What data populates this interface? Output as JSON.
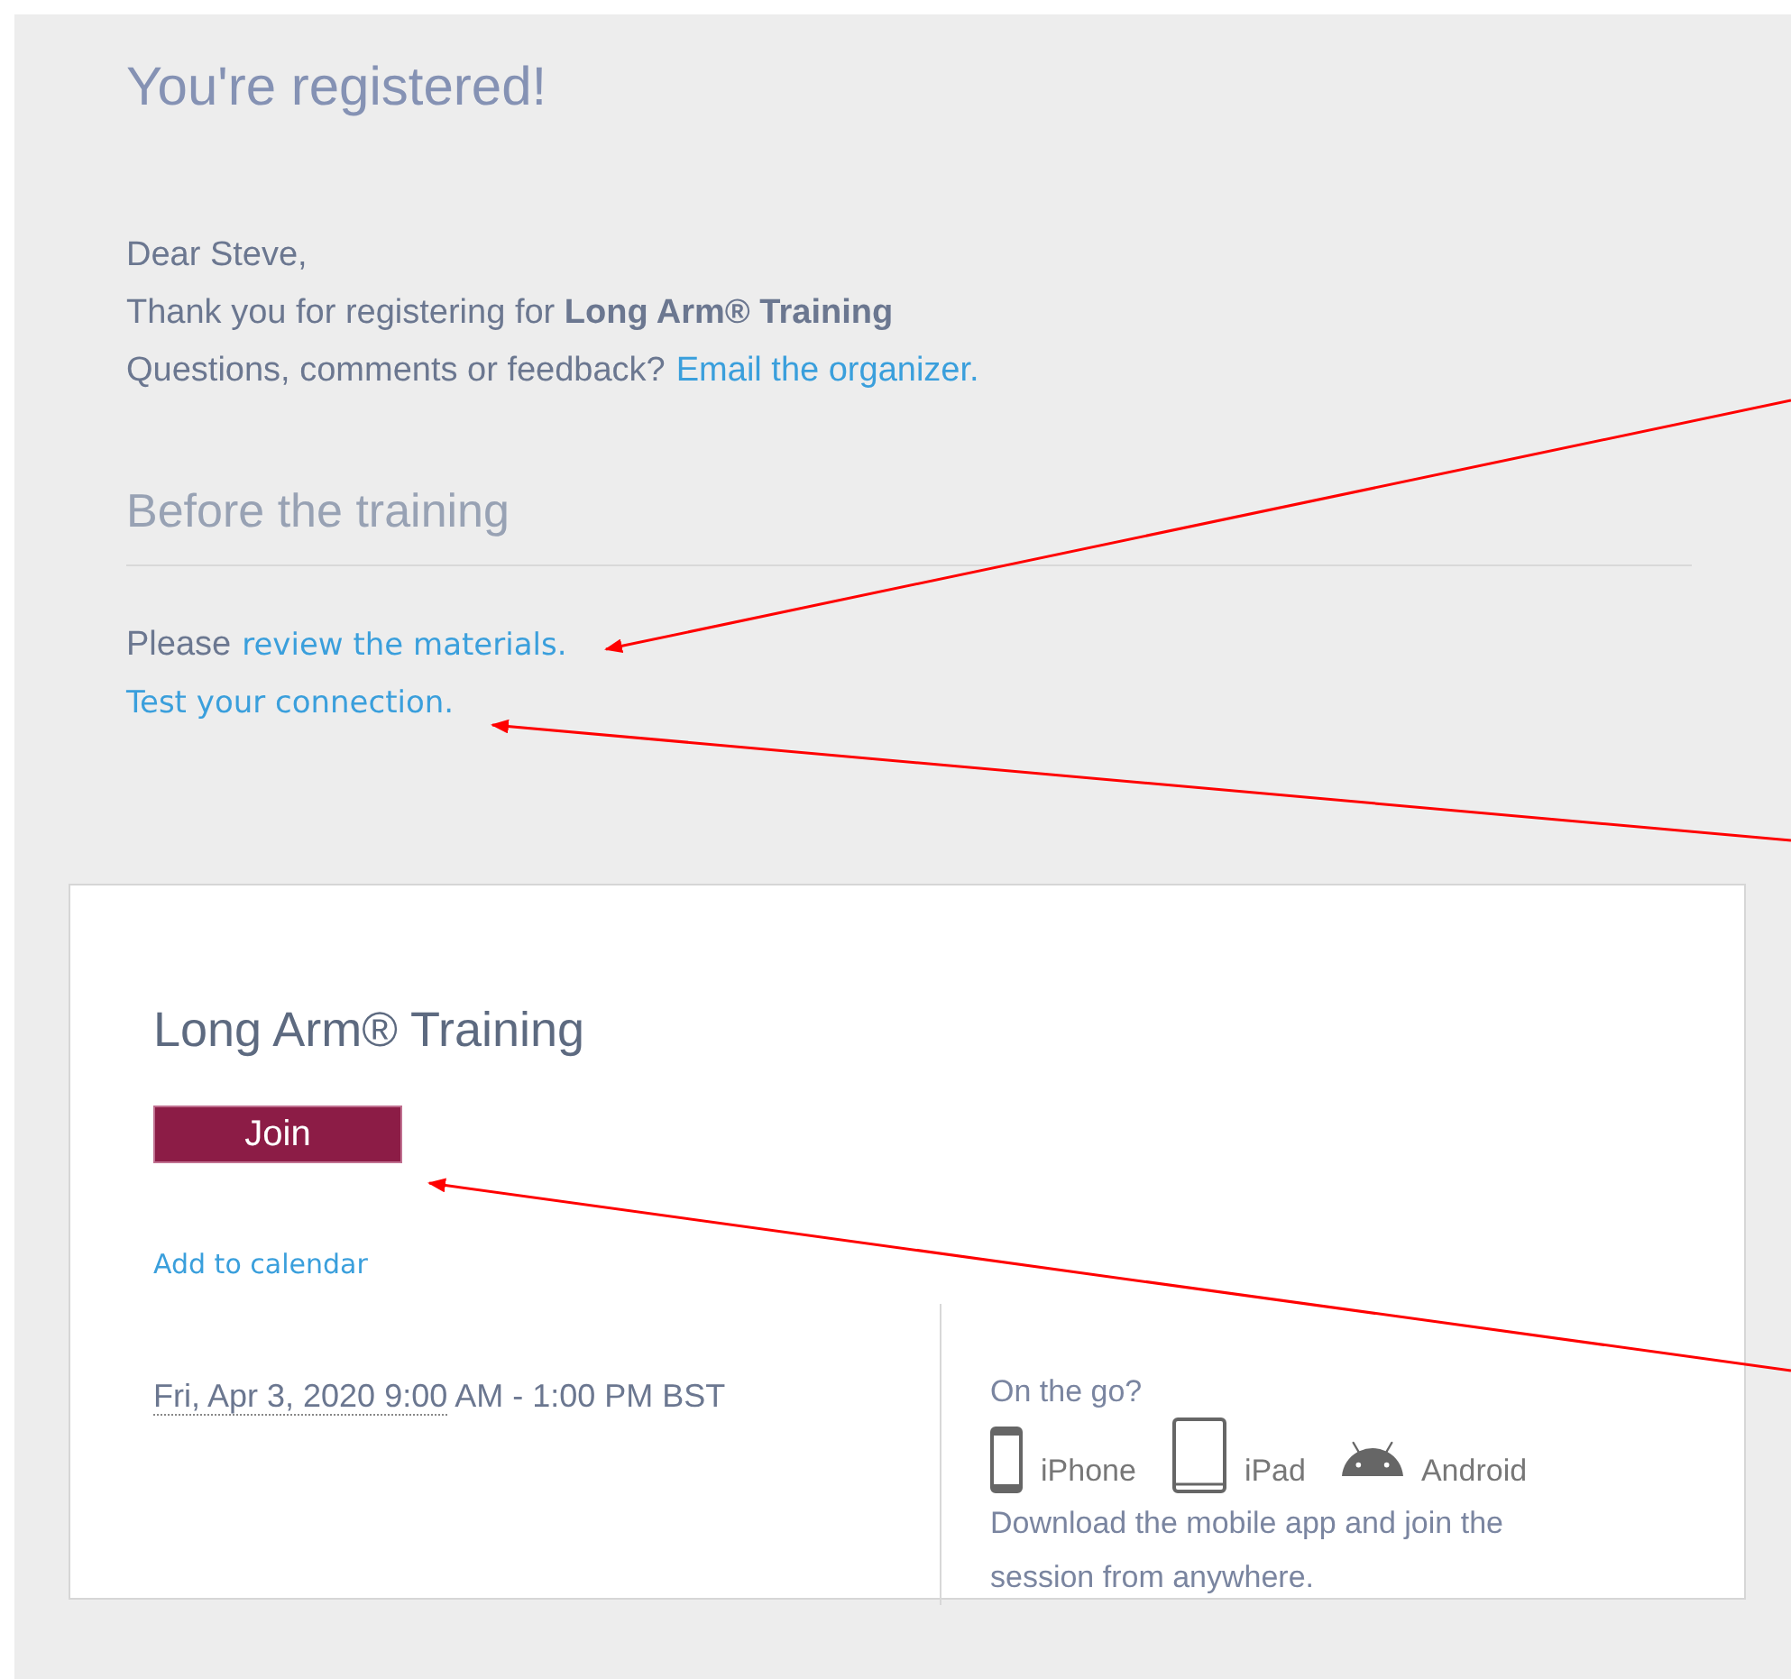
{
  "heading": "You're registered!",
  "greeting": "Dear Steve,",
  "thanks": "Thank you for registering for **Long Arm® Training**",
  "questions": {
    "text": "Questions, comments or feedback?",
    "link": "Email the organizer."
  },
  "before": {
    "title": "Before the training",
    "please": "Please",
    "materials_link": "review the materials.",
    "connection_link": "Test your connection."
  },
  "card": {
    "title": "Long Arm® Training",
    "join_button": "Join",
    "calendar_link": "Add to calendar",
    "date": {
      "underlined": "Fri, Apr 3, 2020 9:00",
      "rest": "AM - 1:00 PM BST"
    },
    "mobile": {
      "title": "On the go?",
      "apps": [
        {
          "kind": "phone",
          "label": "iPhone"
        },
        {
          "kind": "tablet",
          "label": "iPad"
        },
        {
          "kind": "android",
          "label": "Android"
        }
      ],
      "description": "Download the mobile app and join the session from anywhere."
    }
  }
}
